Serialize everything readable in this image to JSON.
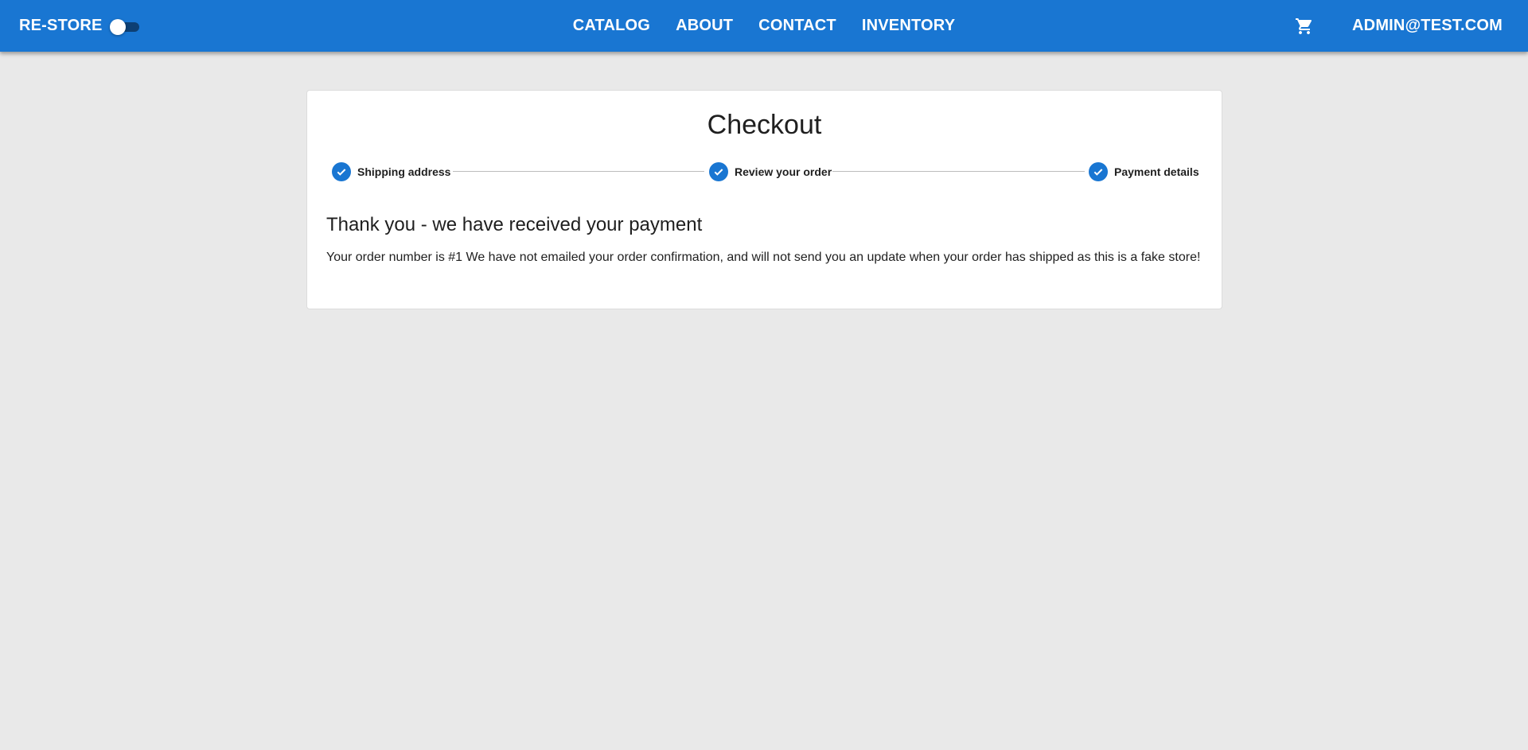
{
  "appbar": {
    "brand": "RE-STORE",
    "nav": [
      "CATALOG",
      "ABOUT",
      "CONTACT",
      "INVENTORY"
    ],
    "user": "ADMIN@TEST.COM",
    "cart_icon": "shopping-cart-icon",
    "theme_toggle_on": false
  },
  "checkout": {
    "title": "Checkout",
    "steps": [
      {
        "label": "Shipping address",
        "icon": "check-icon"
      },
      {
        "label": "Review your order",
        "icon": "check-icon"
      },
      {
        "label": "Payment details",
        "icon": "check-icon"
      }
    ],
    "heading": "Thank you - we have received your payment",
    "message": "Your order number is #1 We have not emailed your order confirmation, and will not send you an update when your order has shipped as this is a fake store!"
  },
  "colors": {
    "primary": "#1976d2",
    "background": "#e9e9e9"
  }
}
